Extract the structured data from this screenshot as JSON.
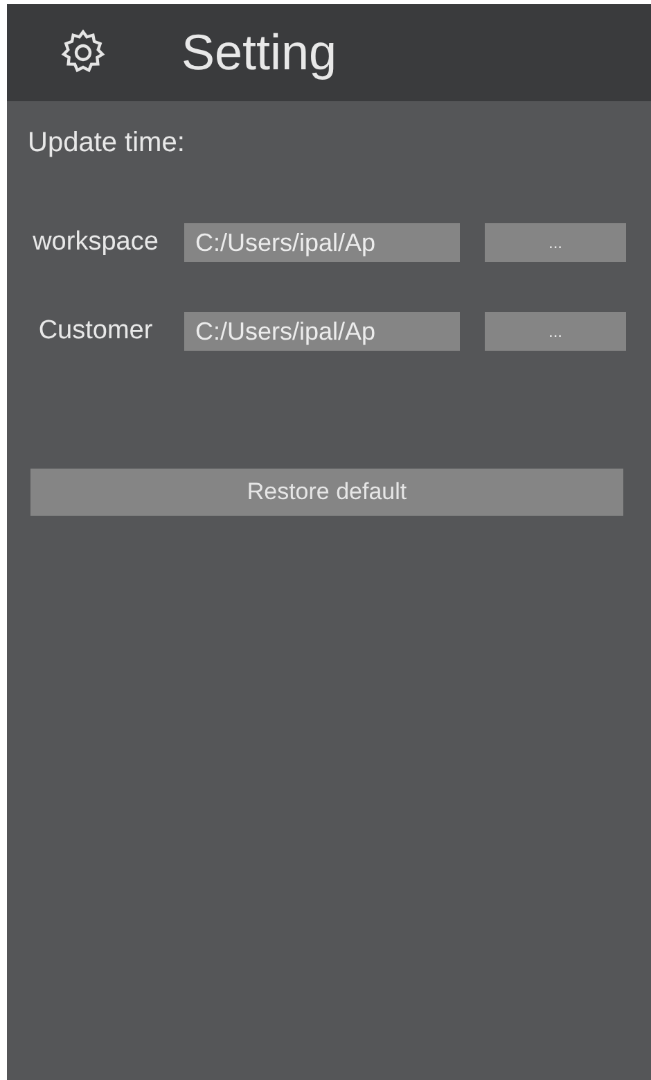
{
  "header": {
    "title": "Setting"
  },
  "update_time": {
    "label": "Update time:"
  },
  "paths": [
    {
      "label": "workspace",
      "value": "C:/Users/ipal/Ap",
      "button": "..."
    },
    {
      "label": "Customer",
      "value": "C:/Users/ipal/Ap",
      "button": "..."
    }
  ],
  "restore_button": "Restore default"
}
